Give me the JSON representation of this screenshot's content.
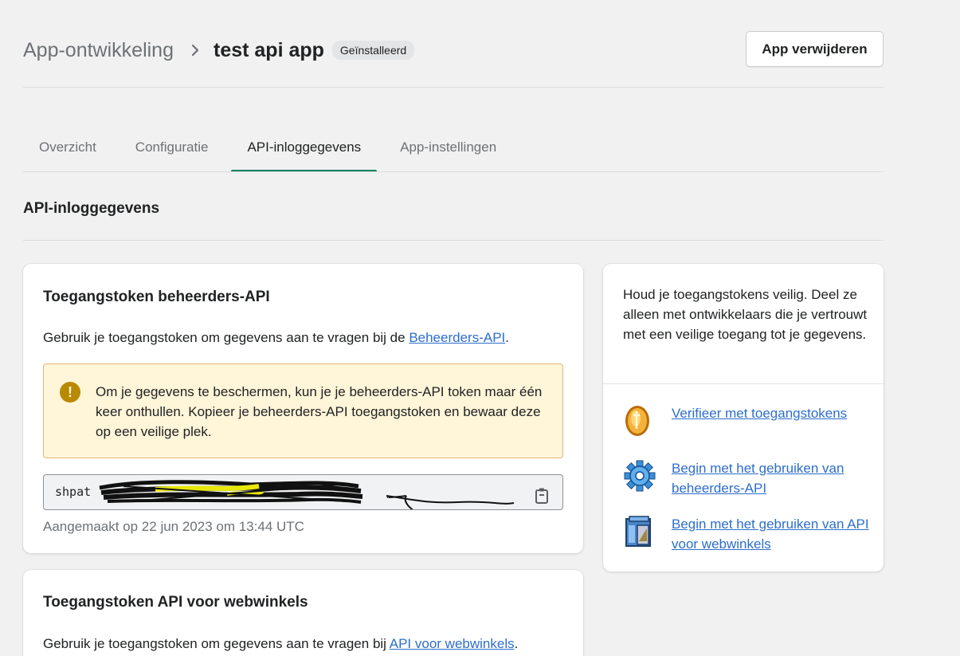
{
  "header": {
    "breadcrumb": "App-ontwikkeling",
    "title": "test api app",
    "badge": "Geïnstalleerd",
    "delete_button": "App verwijderen"
  },
  "tabs": [
    {
      "label": "Overzicht"
    },
    {
      "label": "Configuratie"
    },
    {
      "label": "API-inloggegevens"
    },
    {
      "label": "App-instellingen"
    }
  ],
  "active_tab": "API-inloggegevens",
  "section_title": "API-inloggegevens",
  "admin_card": {
    "title": "Toegangstoken beheerders-API",
    "desc_prefix": "Gebruik je toegangstoken om gegevens aan te vragen bij de ",
    "desc_link": "Beheerders-API",
    "desc_suffix": ".",
    "banner": "Om je gegevens te beschermen, kun je je beheerders-API token maar één keer onthullen. Kopieer je beheerders-API toegangstoken en bewaar deze op een veilige plek.",
    "token_visible": "shpat",
    "created": "Aangemaakt op 22 jun 2023 om 13:44 UTC"
  },
  "storefront_card": {
    "title": "Toegangstoken API voor webwinkels",
    "desc_prefix": "Gebruik je toegangstoken om gegevens aan te vragen bij ",
    "desc_link": "API voor webwinkels",
    "desc_suffix": "."
  },
  "sidebar": {
    "text": "Houd je toegangstokens veilig. Deel ze alleen met ontwikkelaars die je vertrouwt met een veilige toegang tot je gegevens.",
    "resources": [
      {
        "label": "Verifieer met toegangstokens",
        "icon": "coin-icon"
      },
      {
        "label": "Begin met het gebruiken van beheerders-API",
        "icon": "gear-icon"
      },
      {
        "label": "Begin met het gebruiken van API voor webwinkels",
        "icon": "storefront-icon"
      }
    ]
  },
  "colors": {
    "accent": "#008060",
    "link": "#2c6ecb",
    "warning_bg": "#fff5d9",
    "warning_icon": "#b98900"
  }
}
